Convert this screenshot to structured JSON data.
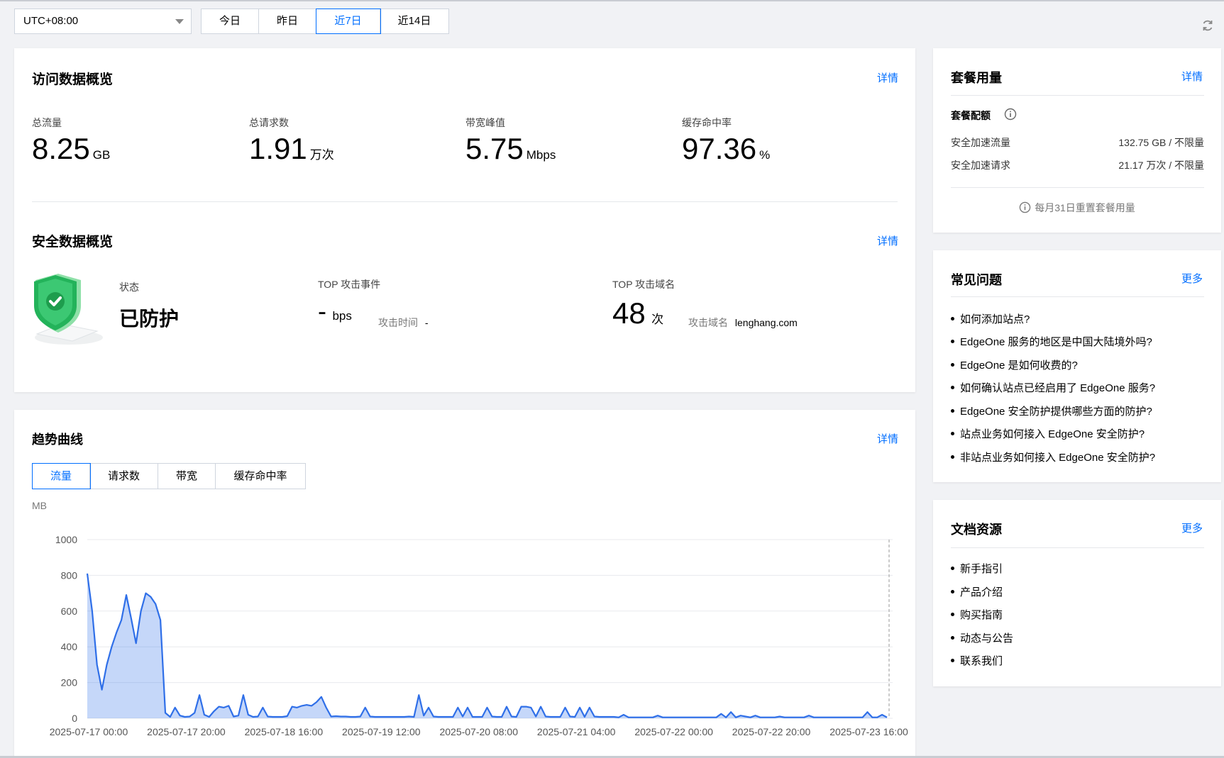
{
  "toolbar": {
    "timezone": "UTC+08:00",
    "ranges": [
      "今日",
      "昨日",
      "近7日",
      "近14日"
    ],
    "active_range": "近7日"
  },
  "access": {
    "title": "访问数据概览",
    "detail": "详情",
    "metrics": [
      {
        "label": "总流量",
        "value": "8.25",
        "unit": "GB"
      },
      {
        "label": "总请求数",
        "value": "1.91",
        "unit": "万次"
      },
      {
        "label": "带宽峰值",
        "value": "5.75",
        "unit": "Mbps"
      },
      {
        "label": "缓存命中率",
        "value": "97.36",
        "unit": "%"
      }
    ]
  },
  "security": {
    "title": "安全数据概览",
    "detail": "详情",
    "status_label": "状态",
    "status_value": "已防护",
    "top_event_label": "TOP 攻击事件",
    "top_event_value": "-",
    "top_event_unit": "bps",
    "attack_time_label": "攻击时间",
    "attack_time_value": "-",
    "top_domain_label": "TOP 攻击域名",
    "top_domain_value": "48",
    "top_domain_unit": "次",
    "attack_domain_label": "攻击域名",
    "attack_domain_value": "lenghang.com"
  },
  "trend": {
    "title": "趋势曲线",
    "detail": "详情",
    "tabs": [
      "流量",
      "请求数",
      "带宽",
      "缓存命中率"
    ],
    "active_tab": "流量",
    "accent": "#2f6fe8"
  },
  "chart_data": {
    "type": "area",
    "ylabel": "MB",
    "ylim": [
      0,
      1000
    ],
    "yticks": [
      0,
      200,
      400,
      600,
      800,
      1000
    ],
    "xticks": [
      "2025-07-17 00:00",
      "2025-07-17 20:00",
      "2025-07-18 16:00",
      "2025-07-19 12:00",
      "2025-07-20 08:00",
      "2025-07-21 04:00",
      "2025-07-22 00:00",
      "2025-07-22 20:00",
      "2025-07-23 16:00"
    ],
    "x_range_hours": [
      0,
      164
    ],
    "points": [
      [
        0,
        810
      ],
      [
        1,
        600
      ],
      [
        2,
        300
      ],
      [
        3,
        160
      ],
      [
        4,
        300
      ],
      [
        5,
        400
      ],
      [
        6,
        480
      ],
      [
        7,
        550
      ],
      [
        8,
        690
      ],
      [
        9,
        560
      ],
      [
        10,
        420
      ],
      [
        11,
        600
      ],
      [
        12,
        700
      ],
      [
        13,
        680
      ],
      [
        14,
        640
      ],
      [
        15,
        550
      ],
      [
        16,
        30
      ],
      [
        17,
        8
      ],
      [
        18,
        60
      ],
      [
        19,
        15
      ],
      [
        20,
        8
      ],
      [
        21,
        10
      ],
      [
        22,
        30
      ],
      [
        23,
        130
      ],
      [
        24,
        20
      ],
      [
        25,
        8
      ],
      [
        26,
        40
      ],
      [
        27,
        65
      ],
      [
        28,
        60
      ],
      [
        29,
        70
      ],
      [
        30,
        10
      ],
      [
        31,
        15
      ],
      [
        32,
        130
      ],
      [
        33,
        20
      ],
      [
        34,
        8
      ],
      [
        35,
        10
      ],
      [
        36,
        60
      ],
      [
        37,
        10
      ],
      [
        38,
        8
      ],
      [
        39,
        8
      ],
      [
        40,
        8
      ],
      [
        41,
        12
      ],
      [
        42,
        65
      ],
      [
        43,
        60
      ],
      [
        44,
        70
      ],
      [
        45,
        75
      ],
      [
        46,
        70
      ],
      [
        47,
        90
      ],
      [
        48,
        120
      ],
      [
        49,
        60
      ],
      [
        50,
        10
      ],
      [
        51,
        12
      ],
      [
        52,
        10
      ],
      [
        53,
        10
      ],
      [
        54,
        8
      ],
      [
        55,
        8
      ],
      [
        56,
        10
      ],
      [
        57,
        60
      ],
      [
        58,
        10
      ],
      [
        59,
        8
      ],
      [
        60,
        8
      ],
      [
        61,
        8
      ],
      [
        62,
        8
      ],
      [
        63,
        8
      ],
      [
        64,
        8
      ],
      [
        65,
        8
      ],
      [
        66,
        10
      ],
      [
        67,
        8
      ],
      [
        68,
        130
      ],
      [
        69,
        15
      ],
      [
        70,
        60
      ],
      [
        71,
        10
      ],
      [
        72,
        8
      ],
      [
        73,
        8
      ],
      [
        74,
        8
      ],
      [
        75,
        8
      ],
      [
        76,
        60
      ],
      [
        77,
        10
      ],
      [
        78,
        60
      ],
      [
        79,
        8
      ],
      [
        80,
        8
      ],
      [
        81,
        8
      ],
      [
        82,
        60
      ],
      [
        83,
        10
      ],
      [
        84,
        8
      ],
      [
        85,
        8
      ],
      [
        86,
        65
      ],
      [
        87,
        10
      ],
      [
        88,
        8
      ],
      [
        89,
        65
      ],
      [
        90,
        65
      ],
      [
        91,
        60
      ],
      [
        92,
        10
      ],
      [
        93,
        65
      ],
      [
        94,
        10
      ],
      [
        95,
        8
      ],
      [
        96,
        8
      ],
      [
        97,
        8
      ],
      [
        98,
        60
      ],
      [
        99,
        10
      ],
      [
        100,
        8
      ],
      [
        101,
        60
      ],
      [
        102,
        8
      ],
      [
        103,
        60
      ],
      [
        104,
        10
      ],
      [
        105,
        8
      ],
      [
        106,
        8
      ],
      [
        107,
        8
      ],
      [
        108,
        8
      ],
      [
        109,
        5
      ],
      [
        110,
        20
      ],
      [
        111,
        5
      ],
      [
        112,
        5
      ],
      [
        113,
        5
      ],
      [
        114,
        5
      ],
      [
        115,
        5
      ],
      [
        116,
        5
      ],
      [
        117,
        15
      ],
      [
        118,
        5
      ],
      [
        119,
        5
      ],
      [
        120,
        5
      ],
      [
        121,
        5
      ],
      [
        122,
        5
      ],
      [
        123,
        5
      ],
      [
        124,
        5
      ],
      [
        125,
        5
      ],
      [
        126,
        5
      ],
      [
        127,
        5
      ],
      [
        128,
        5
      ],
      [
        129,
        5
      ],
      [
        130,
        25
      ],
      [
        131,
        5
      ],
      [
        132,
        35
      ],
      [
        133,
        5
      ],
      [
        134,
        15
      ],
      [
        135,
        10
      ],
      [
        136,
        5
      ],
      [
        137,
        15
      ],
      [
        138,
        5
      ],
      [
        139,
        5
      ],
      [
        140,
        5
      ],
      [
        141,
        5
      ],
      [
        142,
        10
      ],
      [
        143,
        5
      ],
      [
        144,
        5
      ],
      [
        145,
        5
      ],
      [
        146,
        5
      ],
      [
        147,
        5
      ],
      [
        148,
        15
      ],
      [
        149,
        5
      ],
      [
        150,
        5
      ],
      [
        151,
        5
      ],
      [
        152,
        5
      ],
      [
        153,
        5
      ],
      [
        154,
        5
      ],
      [
        155,
        5
      ],
      [
        156,
        5
      ],
      [
        157,
        5
      ],
      [
        158,
        5
      ],
      [
        159,
        5
      ],
      [
        160,
        35
      ],
      [
        161,
        5
      ],
      [
        162,
        5
      ],
      [
        163,
        20
      ],
      [
        164,
        5
      ]
    ]
  },
  "plan": {
    "title": "套餐用量",
    "detail": "详情",
    "quota_label": "套餐配额",
    "rows": [
      {
        "label": "安全加速流量",
        "value": "132.75 GB / 不限量"
      },
      {
        "label": "安全加速请求",
        "value": "21.17 万次 / 不限量"
      }
    ],
    "note": "每月31日重置套餐用量"
  },
  "faq": {
    "title": "常见问题",
    "more": "更多",
    "items": [
      "如何添加站点?",
      "EdgeOne 服务的地区是中国大陆境外吗?",
      "EdgeOne 是如何收费的?",
      "如何确认站点已经启用了 EdgeOne 服务?",
      "EdgeOne 安全防护提供哪些方面的防护?",
      "站点业务如何接入 EdgeOne 安全防护?",
      "非站点业务如何接入 EdgeOne 安全防护?"
    ]
  },
  "docs": {
    "title": "文档资源",
    "more": "更多",
    "items": [
      "新手指引",
      "产品介绍",
      "购买指南",
      "动态与公告",
      "联系我们"
    ]
  }
}
